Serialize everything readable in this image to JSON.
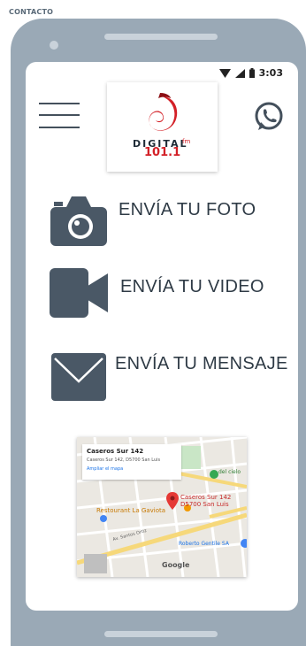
{
  "page": {
    "label": "CONTACTO"
  },
  "status_bar": {
    "time": "3:03"
  },
  "logo": {
    "word": "DIGITAL",
    "frequency": "101.1",
    "band": "fm"
  },
  "actions": [
    {
      "label": "ENVÍA TU FOTO",
      "icon": "camera-icon"
    },
    {
      "label": "ENVÍA TU VIDEO",
      "icon": "video-camera-icon"
    },
    {
      "label": "ENVÍA TU MENSAJE",
      "icon": "envelope-icon"
    }
  ],
  "map": {
    "popup_title": "Caseros Sur 142",
    "popup_address": "Caseros Sur 142, D5700 San Luis",
    "popup_link": "Ampliar el mapa",
    "marker_label_line1": "Caseros Sur 142",
    "marker_label_line2": "D5700 San Luis",
    "poi_restaurant": "Restourant La Gaviota",
    "poi_right": "Roberto Gentile SA",
    "road_label": "Av. Santos Ortiz",
    "poi_top": "del cielo",
    "google": "Google"
  },
  "colors": {
    "frame": "#9aa9b6",
    "icon": "#4a5866",
    "brand_red": "#d32027",
    "whatsapp": "#44505c"
  }
}
